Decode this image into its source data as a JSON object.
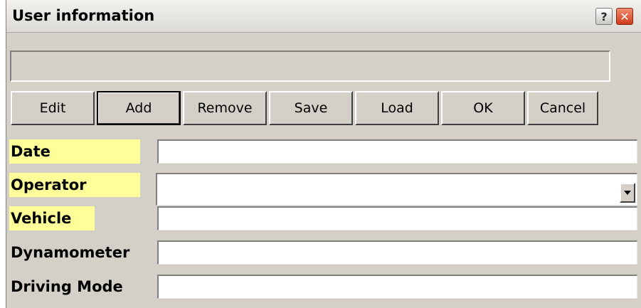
{
  "window": {
    "title": "User information",
    "help_label": "?",
    "close_label": "✕"
  },
  "status": {
    "value": ""
  },
  "toolbar": {
    "edit": "Edit",
    "add": "Add",
    "remove": "Remove",
    "save": "Save",
    "load": "Load",
    "ok": "OK",
    "cancel": "Cancel"
  },
  "form": {
    "date": {
      "label": "Date",
      "value": ""
    },
    "operator": {
      "label": "Operator",
      "value": ""
    },
    "vehicle": {
      "label": "Vehicle",
      "value": ""
    },
    "dynamometer": {
      "label": "Dynamometer",
      "value": ""
    },
    "driving_mode": {
      "label": "Driving Mode",
      "value": ""
    }
  },
  "colors": {
    "required_highlight": "#ffff99",
    "dialog_face": "#d4d0c8"
  },
  "icons": {
    "help": "help-icon",
    "close": "close-icon",
    "dropdown": "chevron-down-icon"
  }
}
